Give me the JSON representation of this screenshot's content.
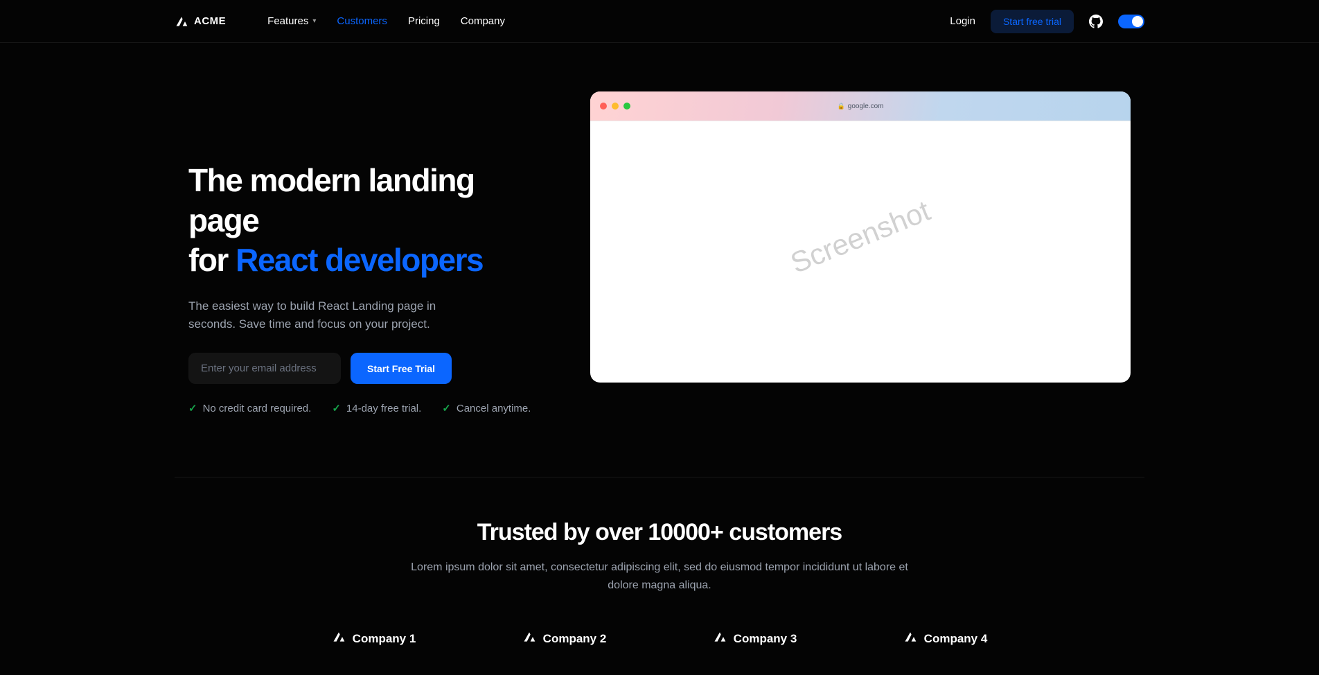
{
  "brand": {
    "name": "ACME"
  },
  "nav": {
    "items": [
      {
        "label": "Features",
        "has_dropdown": true
      },
      {
        "label": "Customers",
        "active": true
      },
      {
        "label": "Pricing"
      },
      {
        "label": "Company"
      }
    ],
    "login": "Login",
    "cta": "Start free trial"
  },
  "hero": {
    "title_line1": "The modern landing page",
    "title_line2_prefix": "for ",
    "title_line2_accent": "React developers",
    "subtitle": "The easiest way to build React Landing page in seconds. Save time and focus on your project.",
    "email_placeholder": "Enter your email address",
    "cta": "Start Free Trial",
    "benefits": [
      "No credit card required.",
      "14-day free trial.",
      "Cancel anytime."
    ]
  },
  "mock_browser": {
    "url": "google.com",
    "watermark": "Screenshot"
  },
  "trusted": {
    "heading": "Trusted by over 10000+ customers",
    "subtitle": "Lorem ipsum dolor sit amet, consectetur adipiscing elit, sed do eiusmod tempor incididunt ut labore et dolore magna aliqua.",
    "companies": [
      "Company 1",
      "Company 2",
      "Company 3",
      "Company 4"
    ]
  }
}
